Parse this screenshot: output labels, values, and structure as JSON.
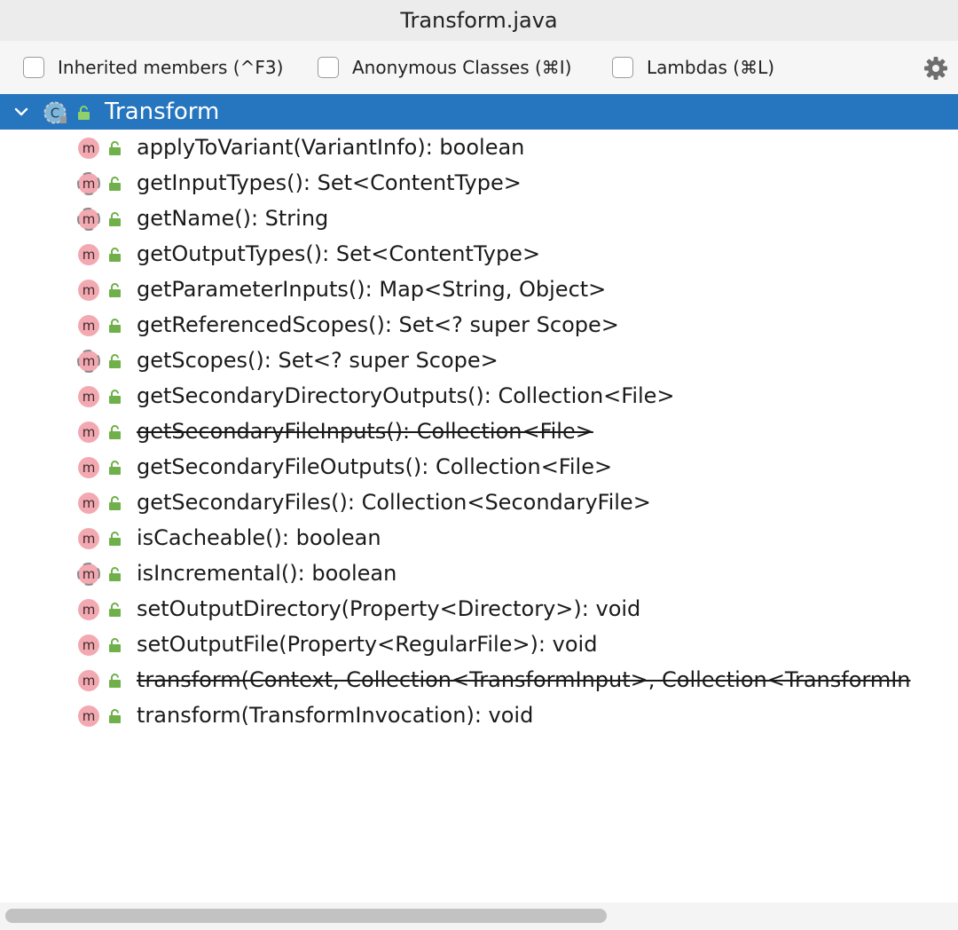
{
  "window": {
    "title": "Transform.java"
  },
  "toolbar": {
    "options": [
      {
        "label": "Inherited members (^F3)",
        "checked": false
      },
      {
        "label": "Anonymous Classes (⌘I)",
        "checked": false
      },
      {
        "label": "Lambdas (⌘L)",
        "checked": false
      }
    ],
    "settings_icon": "gear-icon"
  },
  "tree": {
    "root": {
      "label": "Transform",
      "icon": "abstract-class-icon",
      "expanded": true
    },
    "members": [
      {
        "label": "applyToVariant(VariantInfo): boolean",
        "kind": "method",
        "deprecated": false
      },
      {
        "label": "getInputTypes(): Set<ContentType>",
        "kind": "abstract-method",
        "deprecated": false
      },
      {
        "label": "getName(): String",
        "kind": "abstract-method",
        "deprecated": false
      },
      {
        "label": "getOutputTypes(): Set<ContentType>",
        "kind": "method",
        "deprecated": false
      },
      {
        "label": "getParameterInputs(): Map<String, Object>",
        "kind": "method",
        "deprecated": false
      },
      {
        "label": "getReferencedScopes(): Set<? super Scope>",
        "kind": "method",
        "deprecated": false
      },
      {
        "label": "getScopes(): Set<? super Scope>",
        "kind": "abstract-method",
        "deprecated": false
      },
      {
        "label": "getSecondaryDirectoryOutputs(): Collection<File>",
        "kind": "method",
        "deprecated": false
      },
      {
        "label": "getSecondaryFileInputs(): Collection<File>",
        "kind": "method",
        "deprecated": true
      },
      {
        "label": "getSecondaryFileOutputs(): Collection<File>",
        "kind": "method",
        "deprecated": false
      },
      {
        "label": "getSecondaryFiles(): Collection<SecondaryFile>",
        "kind": "method",
        "deprecated": false
      },
      {
        "label": "isCacheable(): boolean",
        "kind": "method",
        "deprecated": false
      },
      {
        "label": "isIncremental(): boolean",
        "kind": "abstract-method",
        "deprecated": false
      },
      {
        "label": "setOutputDirectory(Property<Directory>): void",
        "kind": "method",
        "deprecated": false
      },
      {
        "label": "setOutputFile(Property<RegularFile>): void",
        "kind": "method",
        "deprecated": false
      },
      {
        "label": "transform(Context, Collection<TransformInput>, Collection<TransformIn",
        "kind": "method",
        "deprecated": true
      },
      {
        "label": "transform(TransformInvocation): void",
        "kind": "method",
        "deprecated": false
      }
    ]
  },
  "colors": {
    "selection": "#2675bf",
    "method_icon": "#f3a9b1",
    "lock_icon": "#6fb04b",
    "titlebar": "#ececec",
    "toolbar": "#f6f6f6"
  }
}
